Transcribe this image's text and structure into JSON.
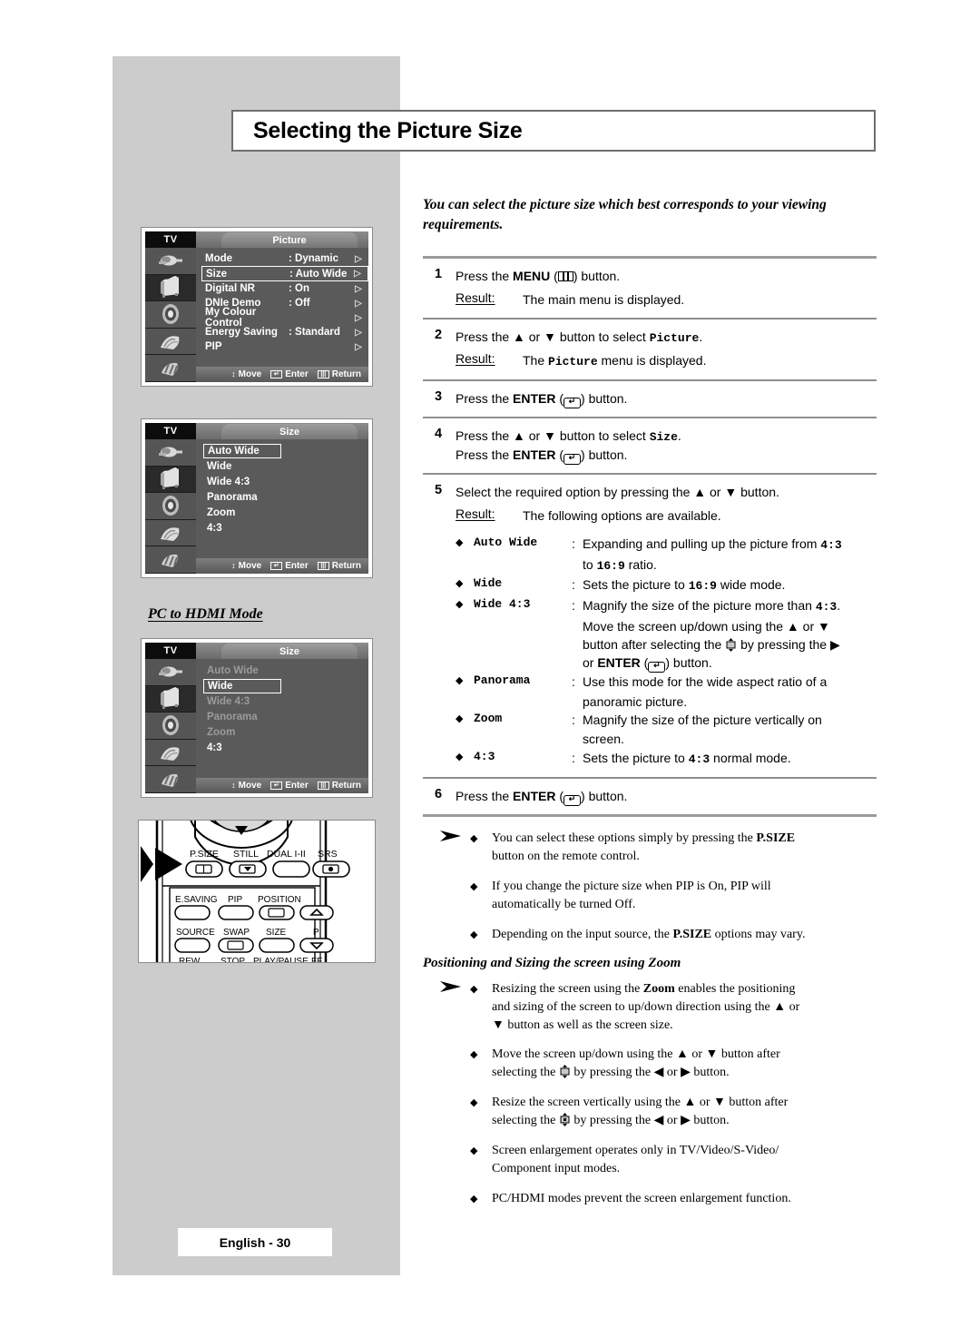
{
  "page": {
    "title": "Selecting the Picture Size",
    "footer": "English - 30",
    "intro": "You can select the picture size which best corresponds to your viewing requirements."
  },
  "osd_picture": {
    "source_label": "TV",
    "tab_label": "Picture",
    "rows": [
      {
        "label": "Mode",
        "value": ": Dynamic",
        "arrow": "▷",
        "highlighted": false
      },
      {
        "label": "Size",
        "value": ": Auto Wide",
        "arrow": "▷",
        "highlighted": true
      },
      {
        "label": "Digital NR",
        "value": ": On",
        "arrow": "▷",
        "highlighted": false
      },
      {
        "label": "DNIe Demo",
        "value": ": Off",
        "arrow": "▷",
        "highlighted": false
      },
      {
        "label": "My Colour Control",
        "value": "",
        "arrow": "▷",
        "highlighted": false
      },
      {
        "label": "Energy Saving",
        "value": ": Standard",
        "arrow": "▷",
        "highlighted": false
      },
      {
        "label": "PIP",
        "value": "",
        "arrow": "▷",
        "highlighted": false
      }
    ],
    "footer": {
      "move": "Move",
      "enter": "Enter",
      "return": "Return"
    },
    "icons": [
      "input-plug-icon",
      "picture-tv-icon",
      "sound-speaker-icon",
      "channel-icon",
      "setup-icon"
    ]
  },
  "osd_size": {
    "source_label": "TV",
    "tab_label": "Size",
    "options": [
      {
        "label": "Auto Wide",
        "highlighted": true,
        "dimmed": false
      },
      {
        "label": "Wide",
        "highlighted": false,
        "dimmed": false
      },
      {
        "label": "Wide 4:3",
        "highlighted": false,
        "dimmed": false
      },
      {
        "label": "Panorama",
        "highlighted": false,
        "dimmed": false
      },
      {
        "label": "Zoom",
        "highlighted": false,
        "dimmed": false
      },
      {
        "label": "4:3",
        "highlighted": false,
        "dimmed": false
      }
    ],
    "footer": {
      "move": "Move",
      "enter": "Enter",
      "return": "Return"
    }
  },
  "pc_hdmi": {
    "heading": "PC to HDMI Mode",
    "source_label": "TV",
    "tab_label": "Size",
    "options": [
      {
        "label": "Auto Wide",
        "highlighted": false,
        "dimmed": true
      },
      {
        "label": "Wide",
        "highlighted": true,
        "dimmed": false
      },
      {
        "label": "Wide 4:3",
        "highlighted": false,
        "dimmed": true
      },
      {
        "label": "Panorama",
        "highlighted": false,
        "dimmed": true
      },
      {
        "label": "Zoom",
        "highlighted": false,
        "dimmed": true
      },
      {
        "label": "4:3",
        "highlighted": false,
        "dimmed": false
      }
    ],
    "footer": {
      "move": "Move",
      "enter": "Enter",
      "return": "Return"
    }
  },
  "remote": {
    "rows": [
      [
        "P.SIZE",
        "STILL",
        "DUAL I-II",
        "SRS"
      ],
      [
        "E.SAVING",
        "PIP",
        "POSITION",
        ""
      ],
      [
        "SOURCE",
        "SWAP",
        "SIZE",
        "P"
      ],
      [
        "REW",
        "STOP",
        "PLAY/PAUSE",
        "FF"
      ]
    ],
    "callout": "psize-pointer-arrow"
  },
  "steps": [
    {
      "num": "1",
      "lines": [
        "Press the ",
        "MENU",
        " (",
        "menu-icon",
        ") button."
      ],
      "text": "Press the MENU ( ) button.",
      "pre": "Press the ",
      "bold": "MENU",
      "post": ") button.",
      "result_label": "Result:",
      "result_text": "The main menu is displayed."
    },
    {
      "num": "2",
      "pre": "Press the ▲ or ▼ button to select ",
      "mono": "Picture",
      "post": ".",
      "result_label": "Result:",
      "result_pre": "The ",
      "result_mono": "Picture",
      "result_post": " menu is displayed."
    },
    {
      "num": "3",
      "pre": "Press the ",
      "bold": "ENTER",
      "post": ") button."
    },
    {
      "num": "4",
      "pre": "Press the ▲ or ▼ button to select ",
      "mono": "Size",
      "post": ".",
      "line2_pre": "Press the ",
      "line2_bold": "ENTER",
      "line2_post": ") button."
    },
    {
      "num": "5",
      "text": "Select the required option by pressing the ▲ or ▼ button.",
      "result_label": "Result:",
      "result_text": "The following options are available."
    },
    {
      "num": "6",
      "pre": "Press the ",
      "bold": "ENTER",
      "post": ") button."
    }
  ],
  "size_options": [
    {
      "name": "Auto Wide",
      "desc_pre": "Expanding and pulling up the picture from ",
      "desc_mono1": "4:3",
      "cont": "to 16:9 ratio.",
      "cont_pre": "to ",
      "cont_mono": "16:9",
      "cont_post": " ratio."
    },
    {
      "name": "Wide",
      "desc_pre": "Sets the picture to ",
      "desc_mono1": "16:9",
      "desc_post": " wide mode."
    },
    {
      "name": "Wide 4:3",
      "desc_pre": "Magnify the size of the picture more than ",
      "desc_mono1": "4:3",
      "desc_post": ".",
      "cont2": "Move the screen up/down using the ▲ or ▼",
      "cont3_pre": "button after selecting the ",
      "cont3_post": " by pressing the ▶",
      "cont4_pre": "or ",
      "cont4_bold": "ENTER",
      "cont4_post": ") button."
    },
    {
      "name": "Panorama",
      "desc_pre": "Use this mode for the wide aspect ratio of a",
      "cont": "panoramic picture."
    },
    {
      "name": "Zoom",
      "desc_pre": "Magnify the size of the picture vertically on",
      "cont": "screen."
    },
    {
      "name": "4:3",
      "desc_pre": "Sets the picture to ",
      "desc_mono1": "4:3",
      "desc_post": " normal mode."
    }
  ],
  "notes": [
    {
      "pre": "You can select these options simply by pressing the ",
      "bold": "P.SIZE",
      "post": "",
      "line2": "button on the remote control."
    },
    {
      "pre": "If you change the picture size when PIP is On, PIP will",
      "line2": "automatically be turned Off."
    },
    {
      "pre": "Depending on the input source, the ",
      "bold": "P.SIZE",
      "post": " options may vary."
    }
  ],
  "zoom_section": {
    "heading": "Positioning and Sizing the screen using Zoom",
    "notes": [
      {
        "pre": "Resizing the screen using the ",
        "bold": "Zoom",
        "post": " enables the positioning",
        "line2": "and sizing of the screen to up/down direction using the ▲ or",
        "line3": "▼ button as well as the screen size."
      },
      {
        "pre": "Move the screen up/down using the ▲ or ▼ button after",
        "line2_pre": "selecting the ",
        "line2_post": " by pressing the ◀ or ▶ button.",
        "glyph": "position-move-icon"
      },
      {
        "pre": "Resize the screen vertically using the ▲ or ▼ button after",
        "line2_pre": "selecting the ",
        "line2_post": " by pressing the ◀ or ▶ button.",
        "glyph": "size-resize-icon"
      },
      {
        "pre": "Screen enlargement operates only in TV/Video/S-Video/",
        "line2": "Component input modes."
      },
      {
        "pre": "PC/HDMI modes prevent the screen enlargement function."
      }
    ]
  },
  "colors": {
    "panel_gray": "#cccccc",
    "osd_bg": "#5a5a5a",
    "osd_tv_bg": "#0c0c0c",
    "text": "#000000"
  }
}
